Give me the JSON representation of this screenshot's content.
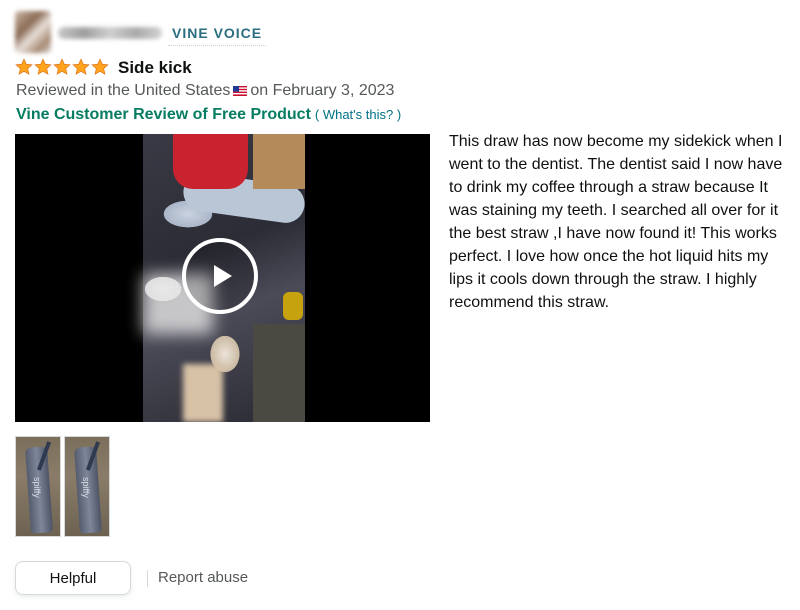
{
  "header": {
    "badge": "VINE VOICE"
  },
  "review": {
    "rating": 5,
    "rating_max": 5,
    "title": "Side kick",
    "reviewed_in": "Reviewed in the United States",
    "date_text": "on February 3, 2023",
    "vine_label": "Vine Customer Review of Free Product",
    "whats_this": "( What's this? )",
    "body": "This draw has now become my sidekick when I went to the dentist. The dentist said I now have to drink my coffee through a straw because It was staining my teeth. I searched all over for it the best straw ,I have now found it! This works perfect. I love how once the hot liquid hits my lips it cools down through the straw. I highly recommend this straw."
  },
  "media": {
    "thumbnail_text": "spiffy"
  },
  "actions": {
    "helpful": "Helpful",
    "report": "Report abuse"
  },
  "colors": {
    "star": "#ffa41c",
    "vine_badge": "#2b6e80",
    "vine_label": "#067d62",
    "link": "#007185"
  },
  "icons": {
    "star": "star-icon",
    "flag": "us-flag-icon",
    "play": "play-icon"
  }
}
